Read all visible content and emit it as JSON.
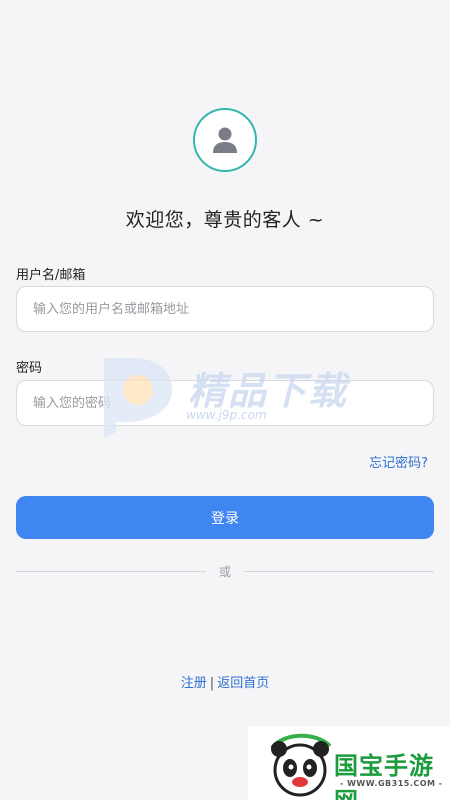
{
  "welcome_text": "欢迎您，尊贵的客人 ~",
  "username": {
    "label": "用户名/邮箱",
    "placeholder": "输入您的用户名或邮箱地址"
  },
  "password": {
    "label": "密码",
    "placeholder": "输入您的密码"
  },
  "forgot_password": "忘记密码?",
  "login_button": "登录",
  "divider_text": "或",
  "bottom": {
    "register": "注册",
    "separator": "|",
    "back_home": "返回首页"
  },
  "watermarks": {
    "j9p_title": "精品下载",
    "j9p_url": "www.j9p.com",
    "gb_title": "国宝手游网",
    "gb_url": "- WWW.GB315.COM -"
  },
  "colors": {
    "accent": "#3f86f2",
    "link": "#2f6fd0",
    "avatar_ring": "#34b6b0",
    "background": "#f5f5f7"
  }
}
